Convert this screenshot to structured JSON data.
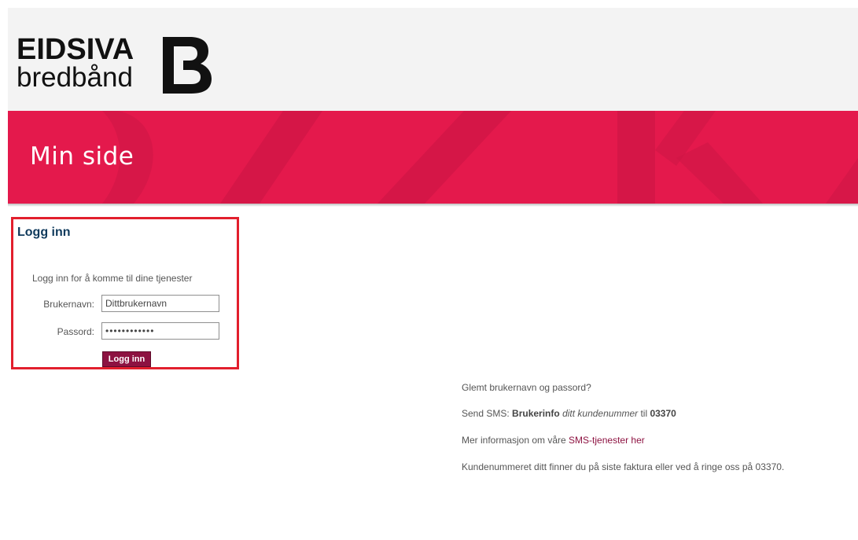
{
  "header": {
    "logo_top": "EIDSIVA",
    "logo_bottom": "bredbånd"
  },
  "banner": {
    "title": "Min side",
    "color": "#e4194c"
  },
  "login": {
    "title": "Logg inn",
    "intro": "Logg inn for å komme til dine tjenester",
    "username_label": "Brukernavn:",
    "username_value": "Dittbrukernavn",
    "password_label": "Passord:",
    "password_value": "••••••••••••",
    "button_label": "Logg inn",
    "highlight_color": "#e21f2d",
    "button_color": "#8d1241"
  },
  "info": {
    "forgot": "Glemt brukernavn og passord?",
    "sms_prefix": "Send SMS: ",
    "sms_keyword": "Brukerinfo",
    "sms_italic": "ditt kundenummer",
    "sms_to": " til ",
    "sms_number": "03370",
    "more_prefix": "Mer informasjon om våre ",
    "more_link": "SMS-tjenester her",
    "customer_number_note": "Kundenummeret ditt finner du på siste faktura eller ved å ringe oss på 03370."
  }
}
